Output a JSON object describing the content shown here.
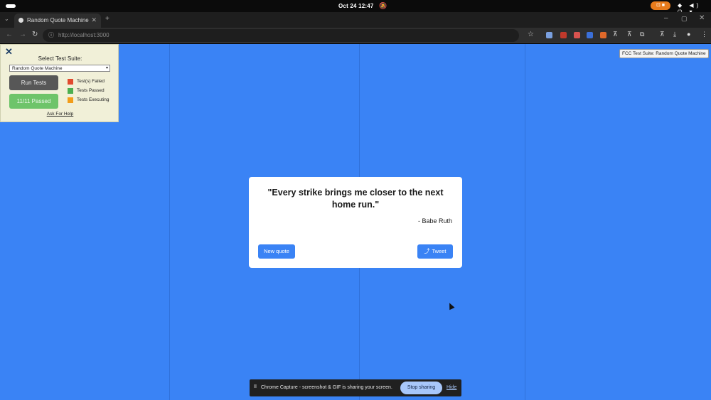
{
  "system_bar": {
    "clock": "Oct 24  12:47",
    "bell_icon": "🔕",
    "recording_icon": "⊡ ■",
    "status_icons": "◆ ◀) ⏻ ▾"
  },
  "browser": {
    "tab_title": "Random Quote Machine",
    "tab_close": "✕",
    "new_tab": "+",
    "tab_menu": "⌄",
    "window_min": "–",
    "window_max": "▢",
    "window_close": "✕",
    "back": "←",
    "forward": "→",
    "reload": "↻",
    "url": "http://localhost:3000",
    "info_icon": "ⓘ",
    "star_icon": "☆",
    "extensions_icon": "⧉",
    "download_icon": "⤓",
    "profile_icon": "●",
    "menu_icon": "⋮",
    "tune_icon": "⊼"
  },
  "fcc": {
    "badge": "FCC Test Suite: Random Quote Machine",
    "close_icon": "✕",
    "title": "Select Test Suite:",
    "select_value": "Random Quote Machine",
    "caret": "▾",
    "run_label": "Run Tests",
    "result_label": "11/11 Passed",
    "legend": [
      {
        "label": "Test(s) Failed",
        "color": "#e14a2f"
      },
      {
        "label": "Tests Passed",
        "color": "#4caf50"
      },
      {
        "label": "Tests Executing",
        "color": "#f29d1b"
      }
    ],
    "help": "Ask For Help"
  },
  "quote": {
    "text": "\"Every strike brings me closer to the next home run.\"",
    "author": "- Babe Ruth",
    "new_quote": "New quote",
    "tweet_icon": "⤴",
    "tweet": "Tweet"
  },
  "share_bar": {
    "pause_icon": "II",
    "message": "Chrome Capture - screenshot & GIF is sharing your screen.",
    "stop": "Stop sharing",
    "hide": "Hide"
  }
}
